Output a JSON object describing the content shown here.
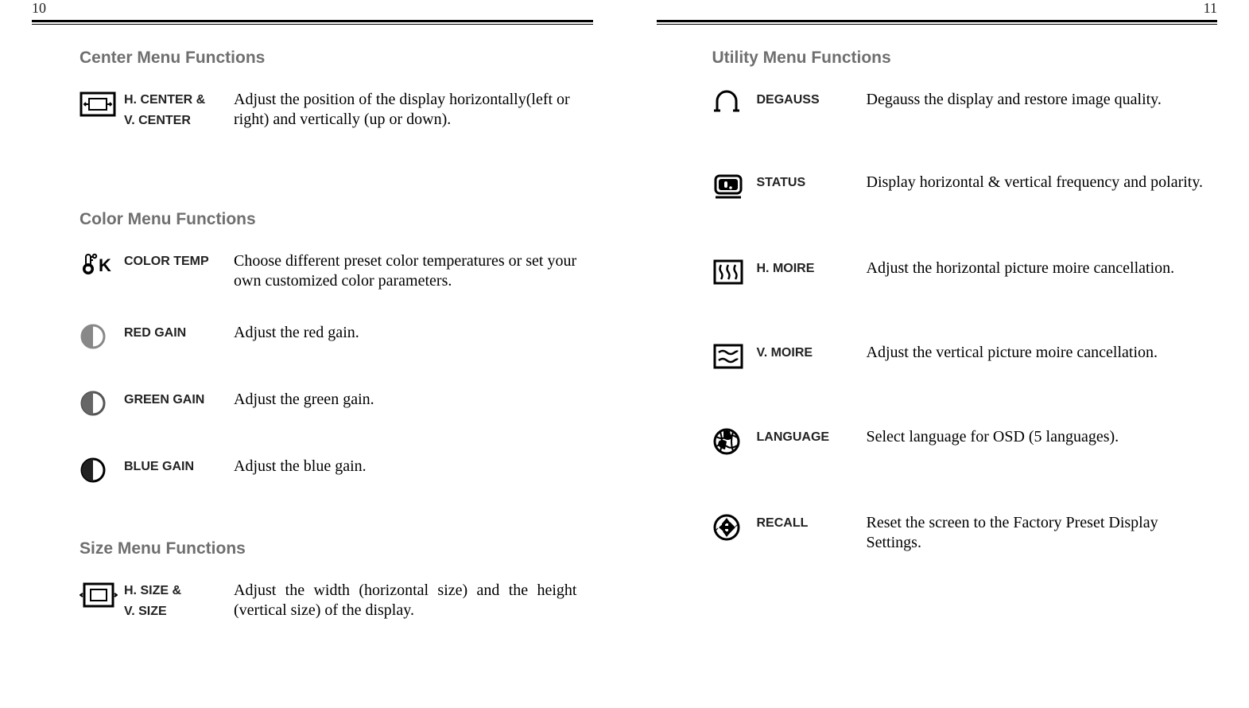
{
  "page_numbers": {
    "left": "10",
    "right": "11"
  },
  "left": {
    "sections": [
      {
        "title": "Center Menu Functions",
        "items": [
          {
            "icon": "center-icon",
            "label_a": "H. CENTER &",
            "label_b": "V. CENTER",
            "desc": "Adjust the position of the display horizontally(left or right) and vertically (up  or down)."
          }
        ]
      },
      {
        "title": "Color Menu Functions",
        "items": [
          {
            "icon": "colortemp-icon",
            "label_a": "COLOR TEMP",
            "desc": "Choose different preset color temperatures or set your own customized color parameters."
          },
          {
            "icon": "redgain-icon",
            "label_a": "RED GAIN",
            "desc": "Adjust the red gain."
          },
          {
            "icon": "greengain-icon",
            "label_a": "GREEN GAIN",
            "desc": "Adjust the green gain."
          },
          {
            "icon": "bluegain-icon",
            "label_a": "BLUE GAIN",
            "desc": "Adjust the blue gain."
          }
        ]
      },
      {
        "title": "Size Menu Functions",
        "items": [
          {
            "icon": "size-icon",
            "label_a": "H. SIZE &",
            "label_b": "V. SIZE",
            "desc": "Adjust the width (horizontal size) and the height (vertical size) of the display."
          }
        ]
      }
    ]
  },
  "right": {
    "sections": [
      {
        "title": "Utility Menu Functions",
        "items": [
          {
            "icon": "degauss-icon",
            "label_a": "DEGAUSS",
            "desc": "Degauss the display and restore image quality."
          },
          {
            "icon": "status-icon",
            "label_a": "STATUS",
            "desc": "Display horizontal & vertical frequency and polarity."
          },
          {
            "icon": "hmoire-icon",
            "label_a": "H. MOIRE",
            "desc": "Adjust the horizontal picture moire cancellation."
          },
          {
            "icon": "vmoire-icon",
            "label_a": "V. MOIRE",
            "desc": "Adjust the vertical picture moire cancellation."
          },
          {
            "icon": "language-icon",
            "label_a": "LANGUAGE",
            "desc": "Select language for OSD (5 languages)."
          },
          {
            "icon": "recall-icon",
            "label_a": "RECALL",
            "desc": "Reset the screen to the Factory Preset Display Settings."
          }
        ]
      }
    ]
  }
}
